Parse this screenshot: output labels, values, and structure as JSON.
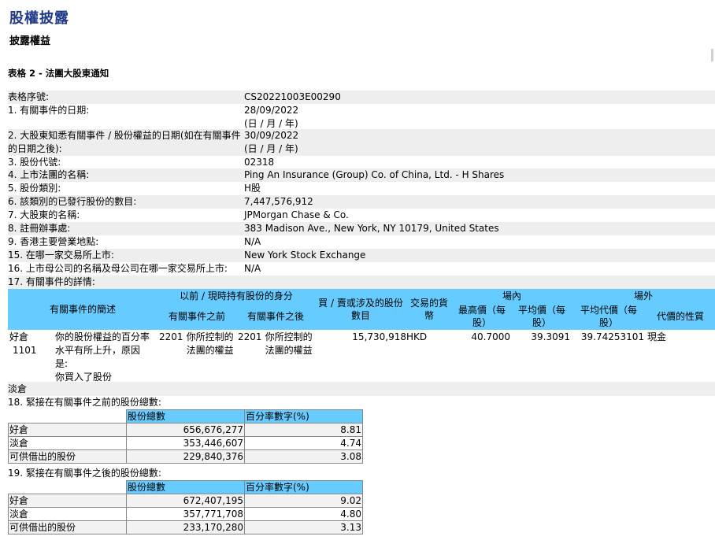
{
  "page": {
    "title": "股權披露",
    "subtitle": "披露權益",
    "form_title": "表格 2 - 法團大股東通知"
  },
  "fields": [
    {
      "label": "表格序號:",
      "value": "CS20221003E00290",
      "value2": ""
    },
    {
      "label": "1. 有關事件的日期:",
      "value": "28/09/2022",
      "value2": "(日 / 月 / 年)"
    },
    {
      "label": "2. 大股東知悉有關事件 / 股份權益的日期(如在有關事件的日期之後):",
      "value": "30/09/2022",
      "value2": "(日 / 月 / 年)"
    },
    {
      "label": "3. 股份代號:",
      "value": "02318",
      "value2": ""
    },
    {
      "label": "4. 上市法團的名稱:",
      "value": "Ping An Insurance (Group) Co. of China, Ltd. - H Shares",
      "value2": ""
    },
    {
      "label": "5. 股份類別:",
      "value": "H股",
      "value2": ""
    },
    {
      "label": "6. 該類別的已發行股份的數目:",
      "value": "7,447,576,912",
      "value2": ""
    },
    {
      "label": "7. 大股東的名稱:",
      "value": "JPMorgan Chase & Co.",
      "value2": ""
    },
    {
      "label": "8. 註冊辦事處:",
      "value": "383 Madison Ave., New York, NY 10179, United States",
      "value2": ""
    },
    {
      "label": "9. 香港主要營業地點:",
      "value": "N/A",
      "value2": ""
    },
    {
      "label": "15. 在哪一家交易所上市:",
      "value": "New York Stock Exchange",
      "value2": ""
    },
    {
      "label": "16. 上市母公司的名稱及母公司在哪一家交易所上市:",
      "value": "N/A",
      "value2": ""
    },
    {
      "label": "17. 有關事件的詳情:",
      "value": "",
      "value2": ""
    }
  ],
  "event_table": {
    "headers": {
      "brief": "有關事件的簡述",
      "capacity_group": "以前 / 現時持有股份的身分",
      "before": "有關事件之前",
      "after": "有關事件之後",
      "shares": "買 / 賣或涉及的股份數目",
      "currency": "交易的貨幣",
      "on_exchange": "場內",
      "highest": "最高價（每股）",
      "average": "平均價（每股）",
      "off_exchange": "場外",
      "avg_consideration": "平均代價（每股）",
      "nature": "代價的性質"
    },
    "row": {
      "position": "好倉",
      "code": "1101",
      "description_lines": [
        "你的股份權益的百分率",
        "水平有所上升，原因",
        "是:",
        "你買入了股份"
      ],
      "before_code": "2201",
      "before_lines": [
        "你所控制的",
        "法團的權益"
      ],
      "after_code": "2201",
      "after_lines": [
        "你所控制的",
        "法團的權益"
      ],
      "shares": "15,730,918",
      "currency": "HKD",
      "highest": "40.7000",
      "average": "39.3091",
      "avg_consideration": "39.74253101",
      "nature": "現金"
    },
    "short_label": "淡倉"
  },
  "section18": {
    "heading": "18. 緊接在有關事件之前的股份總數:",
    "col_total": "股份總數",
    "col_pct": "百分率數字(%)",
    "rows": [
      {
        "label": "好倉",
        "total": "656,676,277",
        "pct": "8.81"
      },
      {
        "label": "淡倉",
        "total": "353,446,607",
        "pct": "4.74"
      },
      {
        "label": "可供借出的股份",
        "total": "229,840,376",
        "pct": "3.08"
      }
    ]
  },
  "section19": {
    "heading": "19. 緊接在有關事件之後的股份總數:",
    "col_total": "股份總數",
    "col_pct": "百分率數字(%)",
    "rows": [
      {
        "label": "好倉",
        "total": "672,407,195",
        "pct": "9.02"
      },
      {
        "label": "淡倉",
        "total": "357,771,708",
        "pct": "4.80"
      },
      {
        "label": "可供借出的股份",
        "total": "233,170,280",
        "pct": "3.13"
      }
    ]
  }
}
